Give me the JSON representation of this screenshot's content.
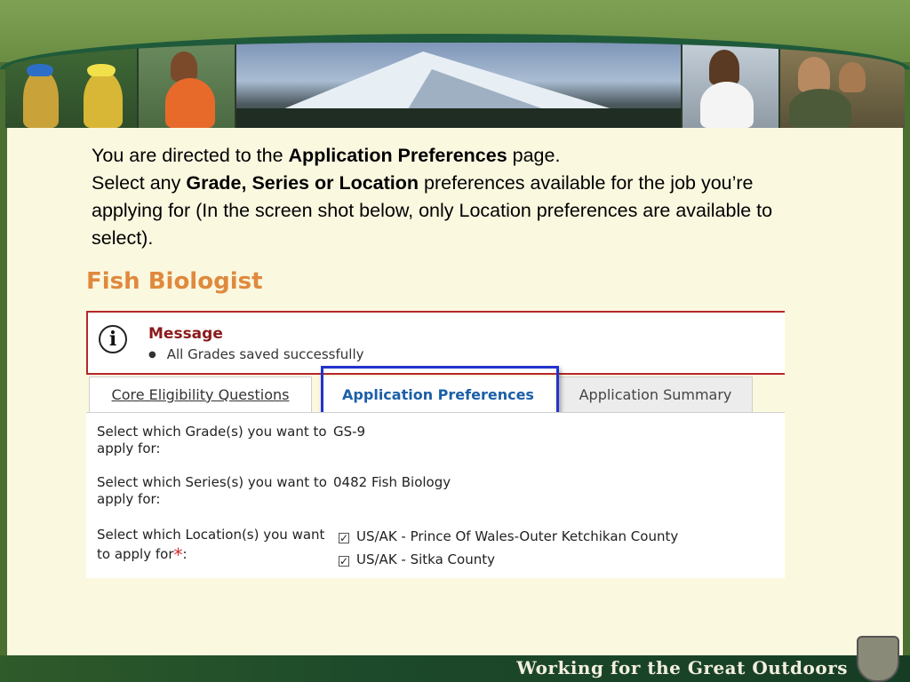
{
  "slide": {
    "intro_line1_pre": "You are directed to the ",
    "intro_line1_bold": "Application Preferences",
    "intro_line1_post": " page.",
    "intro_line2_pre": "Select any ",
    "intro_line2_bold": "Grade, Series or Location",
    "intro_line2_post": " preferences available for the job you’re applying for (In the screen shot below, only Location preferences are available to select).",
    "footer_text": "Working for the Great Outdoors"
  },
  "job": {
    "title": "Fish Biologist"
  },
  "message": {
    "icon": "info-icon",
    "title": "Message",
    "item": "All Grades saved successfully"
  },
  "tabs": [
    {
      "label": "Core Eligibility Questions"
    },
    {
      "label": "Application Preferences",
      "selected": true
    },
    {
      "label": "Application Summary"
    }
  ],
  "form": {
    "grade_label": "Select which Grade(s) you want to apply for:",
    "grade_value": "GS-9",
    "series_label": "Select which Series(s) you want to apply for:",
    "series_value": "0482 Fish Biology",
    "location_label": "Select which Location(s) you want to apply for",
    "location_required": "*",
    "location_suffix": ":",
    "locations": [
      {
        "label": "US/AK - Prince Of Wales-Outer Ketchikan County",
        "checked": true
      },
      {
        "label": "US/AK - Sitka County",
        "checked": true
      }
    ]
  },
  "colors": {
    "job_title": "#e0893d",
    "message_border": "#b5282a",
    "selected_tab_text": "#1c5fa8",
    "highlight_box": "#2233cc"
  }
}
